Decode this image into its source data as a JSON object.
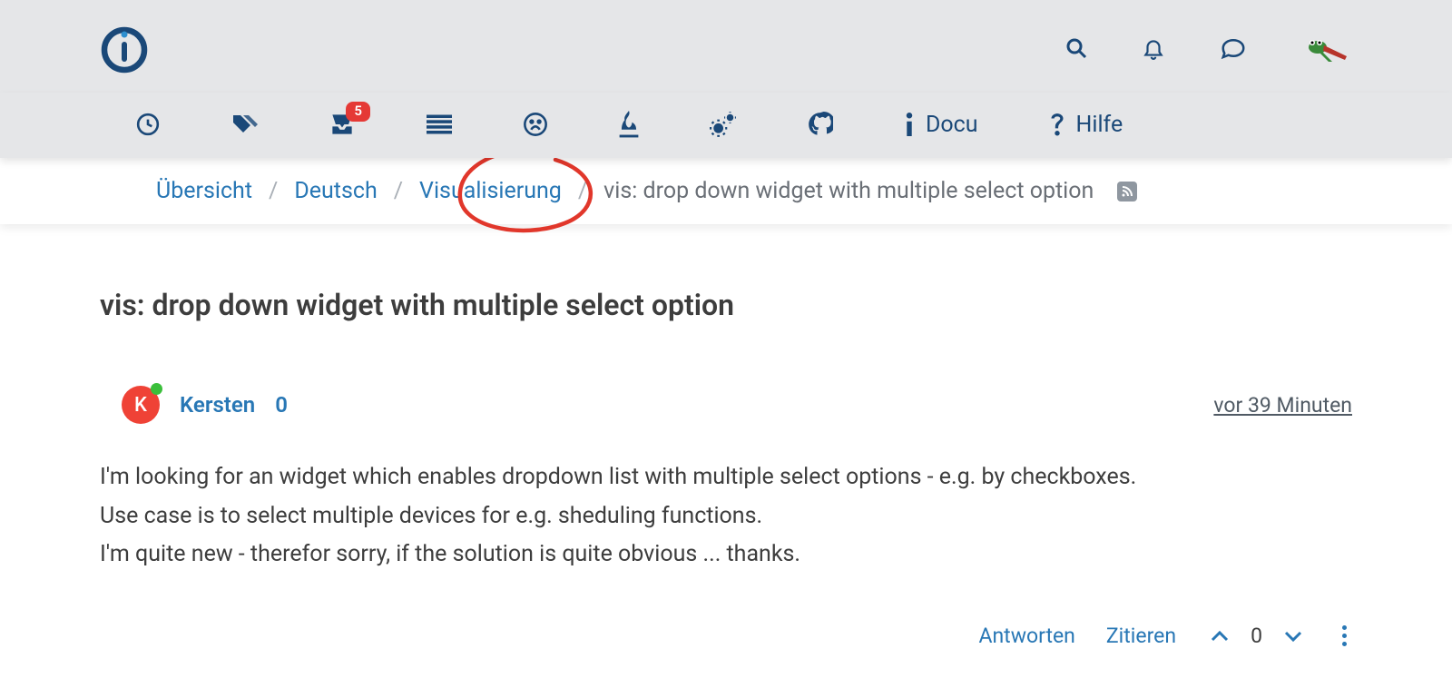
{
  "nav": {
    "badge_count": "5",
    "docu_label": "Docu",
    "hilfe_label": "Hilfe"
  },
  "breadcrumb": {
    "overview": "Übersicht",
    "lang": "Deutsch",
    "category": "Visualisierung",
    "current": "vis: drop down widget with multiple select option"
  },
  "post": {
    "title": "vis: drop down widget with multiple select option",
    "author_initial": "K",
    "author_name": "Kersten",
    "author_rep": "0",
    "timestamp": "vor 39 Minuten",
    "body_line1": "I'm looking for an widget which enables dropdown list with multiple select options - e.g. by checkboxes.",
    "body_line2": "Use case is to select multiple devices for e.g. sheduling functions.",
    "body_line3": "I'm quite new - therefor sorry, if the solution is quite obvious ... thanks."
  },
  "footer": {
    "reply": "Antworten",
    "quote": "Zitieren",
    "votes": "0"
  }
}
